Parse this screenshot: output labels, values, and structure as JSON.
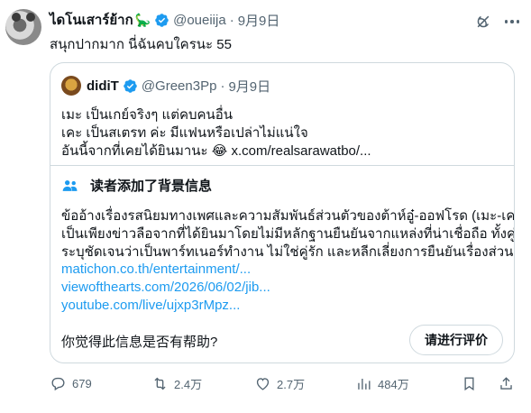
{
  "author": {
    "display_name": "ไดโนเสาร์ย้าก",
    "emoji": "🦕",
    "handle": "@oueiija",
    "separator": "·",
    "date": "9月9日"
  },
  "post_text": "สนุกปากมาก นี่ฉันคบใครนะ 55",
  "quoted": {
    "display_name": "didiT",
    "handle": "@Green3Pp",
    "separator": "·",
    "date": "9月9日",
    "lines": [
      "เมะ เป็นเกย์จริงๆ แต่คบคนอื่น",
      "เคะ เป็นสเตรท ค่ะ มีแฟนหรือเปล่าไม่แน่ใจ"
    ],
    "last_line_text": "อันนี้จากที่เคยได้ยินมานะ",
    "last_line_emoji": "😂",
    "last_line_link": "x.com/realsarawatbo/..."
  },
  "community_note": {
    "title": "读者添加了背景信息",
    "body_lines": [
      "ข้ออ้างเรื่องรสนิยมทางเพศและความสัมพันธ์ส่วนตัวของต้าห์อู๋-ออฟโรด (เมะ-เคะ)",
      "เป็นเพียงข่าวลือจากที่ได้ยินมาโดยไม่มีหลักฐานยืนยันจากแหล่งที่น่าเชื่อถือ ทั้งคู่",
      "ระบุชัดเจนว่าเป็นพาร์ทเนอร์ทำงาน ไม่ใช่คู่รัก และหลีกเลี่ยงการยืนยันเรื่องส่วนตัว"
    ],
    "links": [
      "matichon.co.th/entertainment/...",
      "viewofthearts.com/2026/06/02/jib...",
      "youtube.com/live/ujxp3rMpz..."
    ],
    "helpful_question": "你觉得此信息是否有帮助?",
    "rate_button": "请进行评价"
  },
  "actions": {
    "replies": "679",
    "reposts": "2.4万",
    "likes": "2.7万",
    "views": "484万"
  },
  "colors": {
    "accent": "#1d9bf0",
    "text": "#0f1419",
    "muted": "#536471",
    "border": "#cfd9de"
  },
  "icons": [
    "verified-icon",
    "grok-icon",
    "more-icon",
    "people-icon",
    "reply-icon",
    "repost-icon",
    "like-icon",
    "views-icon",
    "bookmark-icon",
    "share-icon"
  ]
}
